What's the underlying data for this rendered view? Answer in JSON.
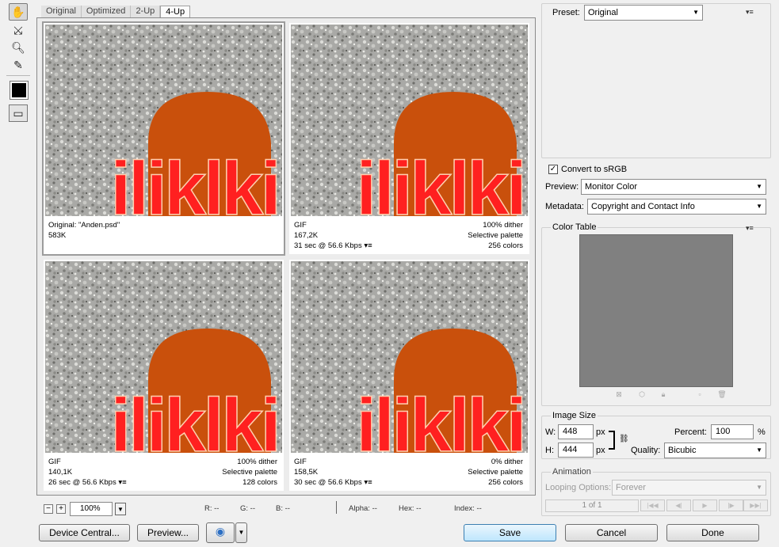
{
  "toolbar": {
    "tools": [
      "hand-tool",
      "slice-select-tool",
      "zoom-tool",
      "eyedropper-tool"
    ],
    "swatch_color": "#000000"
  },
  "tabs": [
    "Original",
    "Optimized",
    "2-Up",
    "4-Up"
  ],
  "image_text": "iliklkil",
  "panels": [
    {
      "left1": "Original: \"Anden.psd\"",
      "left2": "583K",
      "left3": "",
      "right1": "",
      "right2": "",
      "right3": ""
    },
    {
      "left1": "GIF",
      "left2": "167,2K",
      "left3": "31 sec @ 56.6 Kbps",
      "right1": "100% dither",
      "right2": "Selective palette",
      "right3": "256 colors"
    },
    {
      "left1": "GIF",
      "left2": "140,1K",
      "left3": "26 sec @ 56.6 Kbps",
      "right1": "100% dither",
      "right2": "Selective palette",
      "right3": "128 colors"
    },
    {
      "left1": "GIF",
      "left2": "158,5K",
      "left3": "30 sec @ 56.6 Kbps",
      "right1": "0% dither",
      "right2": "Selective palette",
      "right3": "256 colors"
    }
  ],
  "status": {
    "zoom": "100%",
    "r": "R: --",
    "g": "G: --",
    "b": "B: --",
    "alpha": "Alpha: --",
    "hex": "Hex: --",
    "index": "Index: --"
  },
  "buttons": {
    "device_central": "Device Central...",
    "preview": "Preview...",
    "save": "Save",
    "cancel": "Cancel",
    "done": "Done"
  },
  "settings": {
    "preset_label": "Preset:",
    "preset_value": "Original",
    "convert_srgb": "Convert to sRGB",
    "preview_label": "Preview:",
    "preview_value": "Monitor Color",
    "metadata_label": "Metadata:",
    "metadata_value": "Copyright and Contact Info"
  },
  "color_table": {
    "title": "Color Table",
    "bg": "#808080"
  },
  "image_size": {
    "title": "Image Size",
    "w_label": "W:",
    "w_value": "448",
    "w_unit": "px",
    "h_label": "H:",
    "h_value": "444",
    "h_unit": "px",
    "percent_label": "Percent:",
    "percent_value": "100",
    "percent_unit": "%",
    "quality_label": "Quality:",
    "quality_value": "Bicubic"
  },
  "animation": {
    "title": "Animation",
    "looping_label": "Looping Options:",
    "looping_value": "Forever",
    "frame_counter": "1 of 1"
  }
}
